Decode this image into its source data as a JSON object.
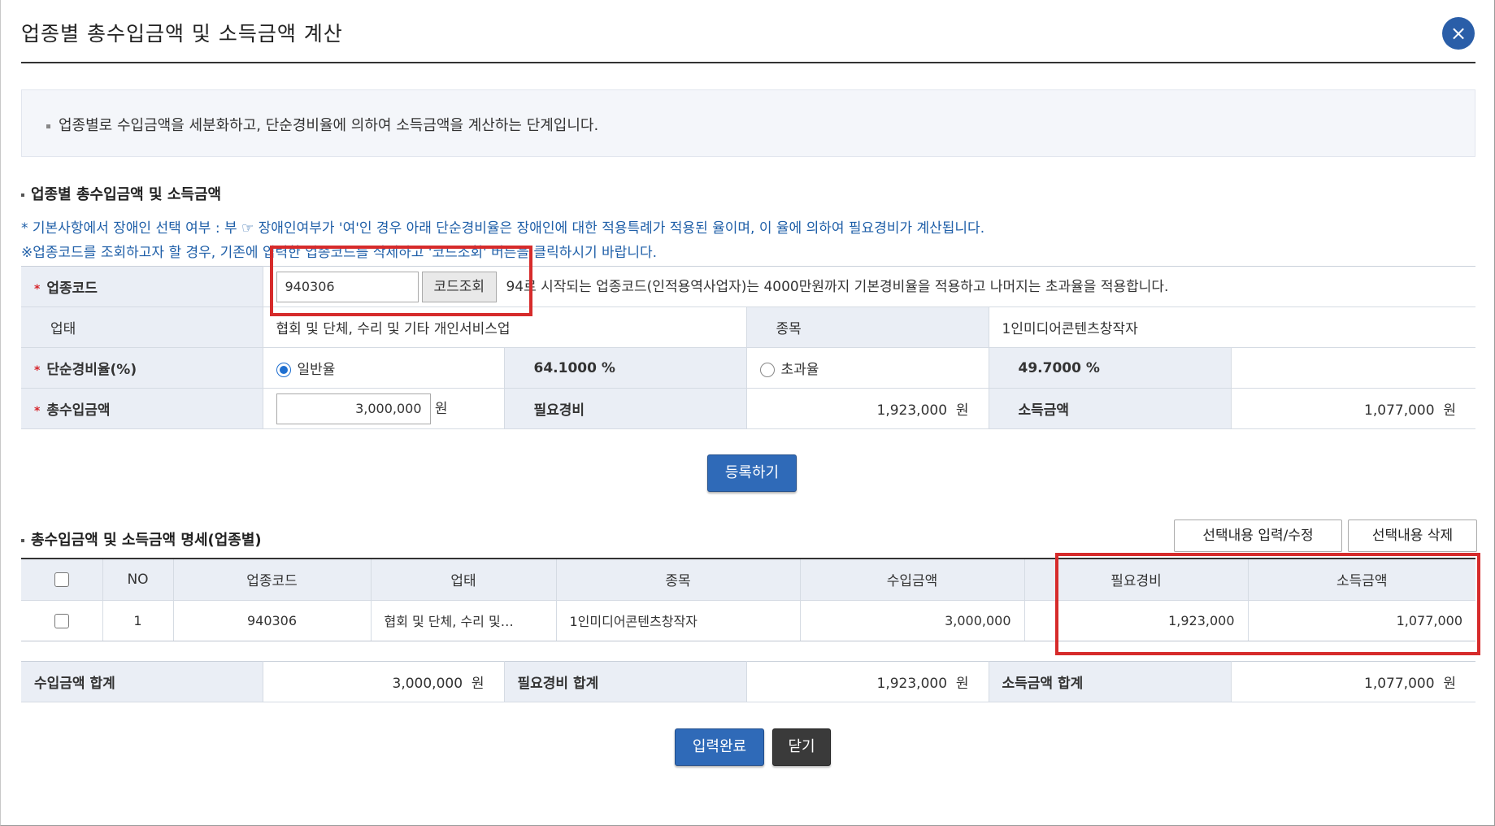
{
  "dialog": {
    "title": "업종별 총수입금액 및 소득금액 계산",
    "close_glyph": "×",
    "notice": "업종별로 수입금액을 세분화하고, 단순경비율에 의하여 소득금액을 계산하는 단계입니다."
  },
  "section1": {
    "title": "업종별 총수입금액 및 소득금액",
    "disability_line": "* 기본사항에서 장애인 선택 여부 : 부  ☞ 장애인여부가 '여'인 경우 아래 단순경비율은 장애인에 대한 적용특례가 적용된 율이며, 이 율에 의하여 필요경비가 계산됩니다.",
    "code_notice": "※업종코드를 조회하고자 할 경우, 기존에 입력한 업종코드를 삭제하고 '코드조회' 버튼을 클릭하시기 바랍니다."
  },
  "form": {
    "code_label": "업종코드",
    "code_value": "940306",
    "code_search_button": "코드조회",
    "code_hint": "94로 시작되는 업종코드(인적용역사업자)는 4000만원까지 기본경비율을 적용하고 나머지는 초과율을 적용합니다.",
    "business_type_label": "업태",
    "business_type_value": "협회 및 단체, 수리 및 기타 개인서비스업",
    "item_label": "종목",
    "item_value": "1인미디어콘텐츠창작자",
    "rate_label": "단순경비율(%)",
    "rate_general_label": "일반율",
    "rate_general_value": "64.1000 %",
    "rate_excess_label": "초과율",
    "rate_excess_value": "49.7000 %",
    "revenue_label": "총수입금액",
    "revenue_value": "3,000,000",
    "unit_won": "원",
    "expense_label": "필요경비",
    "expense_value": "1,923,000",
    "income_label": "소득금액",
    "income_value": "1,077,000"
  },
  "register_button": "등록하기",
  "section2": {
    "title": "총수입금액 및 소득금액 명세(업종별)",
    "edit_button": "선택내용 입력/수정",
    "delete_button": "선택내용 삭제"
  },
  "list": {
    "headers": [
      "NO",
      "업종코드",
      "업태",
      "종목",
      "수입금액",
      "필요경비",
      "소득금액"
    ],
    "rows": [
      {
        "no": "1",
        "code": "940306",
        "type": "협회 및 단체, 수리 및…",
        "item": "1인미디어콘텐츠창작자",
        "revenue": "3,000,000",
        "expense": "1,923,000",
        "income": "1,077,000"
      }
    ]
  },
  "totals": {
    "revenue_label": "수입금액 합계",
    "revenue_value": "3,000,000",
    "expense_label": "필요경비 합계",
    "expense_value": "1,923,000",
    "income_label": "소득금액 합계",
    "income_value": "1,077,000",
    "unit": "원"
  },
  "footer": {
    "complete_button": "입력완료",
    "close_button": "닫기"
  },
  "colors": {
    "primary_blue": "#2f6ab8",
    "highlight_red": "#d62b2b",
    "label_bg": "#eaeef5"
  }
}
